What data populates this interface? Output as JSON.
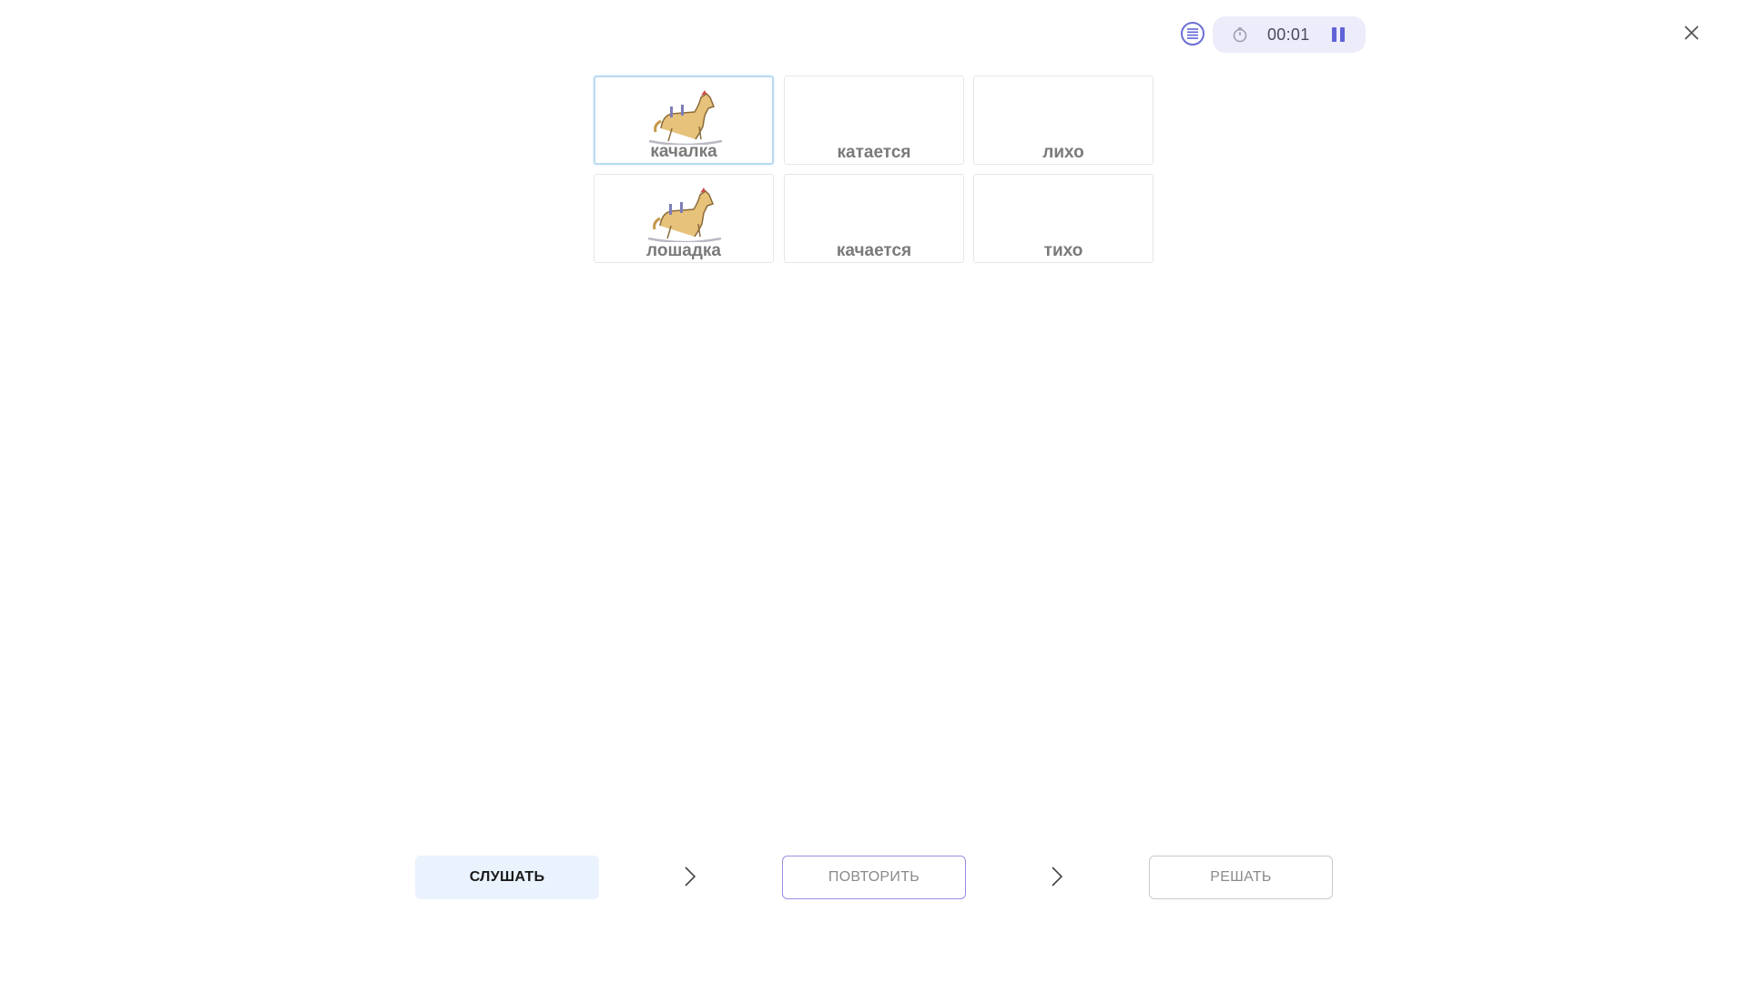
{
  "timer": {
    "time": "00:01"
  },
  "cards": [
    {
      "word": "качалка",
      "has_image": true,
      "selected": true
    },
    {
      "word": "катается",
      "has_image": false,
      "selected": false
    },
    {
      "word": "лихо",
      "has_image": false,
      "selected": false
    },
    {
      "word": "лошадка",
      "has_image": true,
      "selected": false
    },
    {
      "word": "качается",
      "has_image": false,
      "selected": false
    },
    {
      "word": "тихо",
      "has_image": false,
      "selected": false
    }
  ],
  "actions": {
    "listen_label": "СЛУШАТЬ",
    "repeat_label": "ПОВТОРИТЬ",
    "solve_label": "РЕШАТЬ"
  },
  "icons": {
    "menu": "list-icon",
    "timer": "stopwatch-icon",
    "pause": "pause-icon",
    "close": "close-icon",
    "step": "chevron-right-icon"
  },
  "colors": {
    "accent": "#5f63d6",
    "timer_bg": "#ececfb",
    "listen_bg": "#eaf2fd",
    "selected_border": "#b9dbf0"
  }
}
